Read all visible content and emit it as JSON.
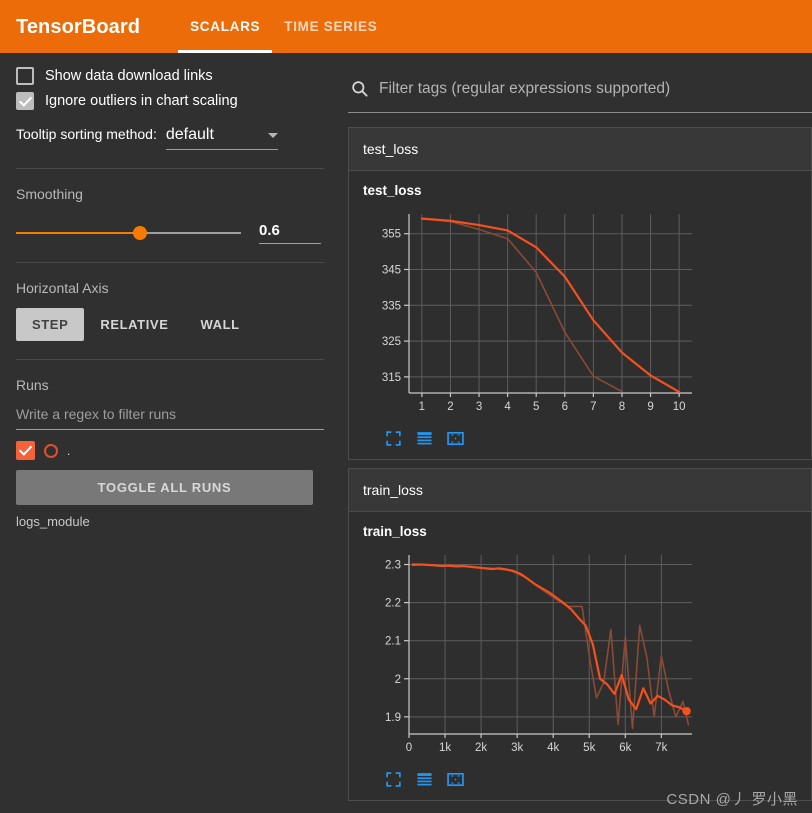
{
  "header": {
    "brand": "TensorBoard",
    "tabs": [
      {
        "label": "SCALARS",
        "active": true
      },
      {
        "label": "TIME SERIES",
        "active": false
      }
    ]
  },
  "sidebar": {
    "checkboxes": [
      {
        "label": "Show data download links",
        "checked": false
      },
      {
        "label": "Ignore outliers in chart scaling",
        "checked": true
      }
    ],
    "tooltip": {
      "label": "Tooltip sorting method:",
      "value": "default"
    },
    "smoothing": {
      "label": "Smoothing",
      "value": "0.6",
      "fraction": 0.55
    },
    "horizontal_axis": {
      "label": "Horizontal Axis",
      "options": [
        {
          "label": "STEP",
          "active": true
        },
        {
          "label": "RELATIVE",
          "active": false
        },
        {
          "label": "WALL",
          "active": false
        }
      ]
    },
    "runs": {
      "label": "Runs",
      "filter_placeholder": "Write a regex to filter runs",
      "run_name": ".",
      "toggle_label": "TOGGLE ALL RUNS",
      "logs_label": "logs_module"
    }
  },
  "main": {
    "search_placeholder": "Filter tags (regular expressions supported)",
    "cards": [
      {
        "group": "test_loss",
        "chart_title": "test_loss"
      },
      {
        "group": "train_loss",
        "chart_title": "train_loss"
      }
    ],
    "tool_icons": [
      "expand-icon",
      "data-table-icon",
      "fit-domain-icon"
    ]
  },
  "watermark": "CSDN @丿 罗小黑",
  "colors": {
    "brand_orange": "#ec6c09",
    "series_orange": "#f4511e",
    "series_faded": "#8a4a34",
    "tool_blue": "#2196f3",
    "background": "#303030"
  },
  "chart_data": [
    {
      "type": "line",
      "title": "test_loss",
      "xlabel": "",
      "ylabel": "",
      "xlim": [
        0.55,
        10.45
      ],
      "ylim": [
        310.5,
        360.5
      ],
      "xticks": [
        1,
        2,
        3,
        4,
        5,
        6,
        7,
        8,
        9,
        10
      ],
      "xticklabels": [
        "1",
        "2",
        "3",
        "4",
        "5",
        "6",
        "7",
        "8",
        "9",
        "10"
      ],
      "yticks": [
        315,
        325,
        335,
        345,
        355
      ],
      "yticklabels": [
        "315",
        "325",
        "335",
        "345",
        "355"
      ],
      "grid": true,
      "legend": "none",
      "series": [
        {
          "name": "smoothed",
          "color": "#f4511e",
          "x": [
            1,
            2,
            3,
            4,
            5,
            6,
            7,
            8,
            9,
            10
          ],
          "values": [
            359.2,
            358.6,
            357.4,
            355.9,
            351.2,
            343.0,
            330.8,
            321.8,
            315.4,
            310.8
          ]
        },
        {
          "name": "raw",
          "color": "#8a4a34",
          "x": [
            1,
            2,
            3,
            4,
            5,
            6,
            7,
            8
          ],
          "values": [
            359.2,
            358.4,
            356.2,
            353.6,
            344.2,
            327.5,
            315.2,
            310.9
          ]
        }
      ]
    },
    {
      "type": "line",
      "title": "train_loss",
      "xlabel": "",
      "ylabel": "",
      "xlim": [
        0,
        7850
      ],
      "ylim": [
        1.855,
        2.325
      ],
      "xticks": [
        0,
        1000,
        2000,
        3000,
        4000,
        5000,
        6000,
        7000
      ],
      "xticklabels": [
        "0",
        "1k",
        "2k",
        "3k",
        "4k",
        "5k",
        "6k",
        "7k"
      ],
      "yticks": [
        1.9,
        2.0,
        2.1,
        2.2,
        2.3
      ],
      "yticklabels": [
        "1.9",
        "2",
        "2.1",
        "2.2",
        "2.3"
      ],
      "grid": true,
      "legend": "none",
      "endpoint_marker": {
        "x": 7700,
        "y": 1.915,
        "color": "#f4511e"
      },
      "series": [
        {
          "name": "smoothed",
          "color": "#f4511e",
          "x": [
            100,
            300,
            500,
            700,
            900,
            1100,
            1300,
            1500,
            1700,
            1900,
            2100,
            2300,
            2500,
            2700,
            2900,
            3100,
            3300,
            3500,
            3700,
            3900,
            4100,
            4300,
            4500,
            4700,
            4900,
            5100,
            5300,
            5500,
            5700,
            5900,
            6100,
            6300,
            6500,
            6700,
            6900,
            7100,
            7300,
            7500,
            7700
          ],
          "values": [
            2.299,
            2.3,
            2.299,
            2.298,
            2.296,
            2.297,
            2.295,
            2.296,
            2.294,
            2.292,
            2.29,
            2.288,
            2.29,
            2.287,
            2.283,
            2.275,
            2.262,
            2.248,
            2.237,
            2.226,
            2.212,
            2.198,
            2.182,
            2.16,
            2.14,
            2.09,
            2.0,
            1.985,
            1.96,
            2.01,
            1.945,
            1.92,
            1.975,
            1.935,
            1.955,
            1.945,
            1.93,
            1.925,
            1.915
          ]
        },
        {
          "name": "raw",
          "color": "#8a4a34",
          "x": [
            100,
            400,
            800,
            1200,
            1600,
            2000,
            2400,
            2800,
            3200,
            3600,
            4000,
            4400,
            4800,
            5000,
            5200,
            5400,
            5600,
            5800,
            6000,
            6200,
            6400,
            6600,
            6800,
            7000,
            7200,
            7400,
            7600,
            7750
          ],
          "values": [
            2.302,
            2.3,
            2.297,
            2.299,
            2.296,
            2.292,
            2.289,
            2.285,
            2.268,
            2.24,
            2.214,
            2.19,
            2.19,
            2.06,
            1.95,
            1.99,
            2.13,
            1.88,
            2.11,
            1.87,
            2.14,
            2.055,
            1.9,
            2.06,
            1.97,
            1.9,
            1.94,
            1.88
          ]
        }
      ]
    }
  ]
}
